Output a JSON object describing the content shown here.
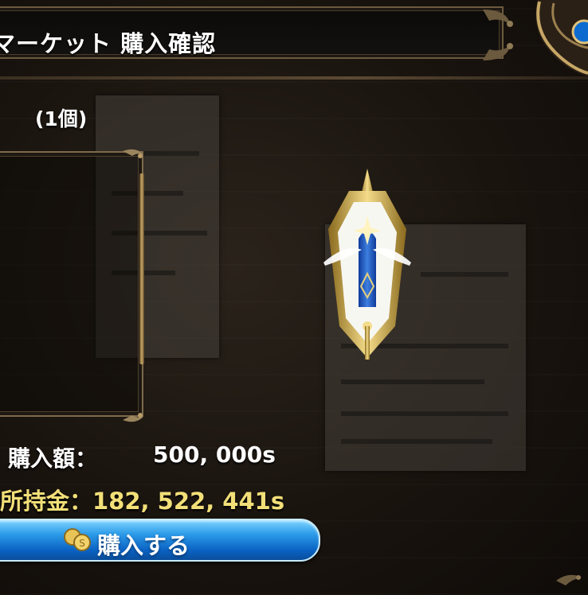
{
  "header": {
    "title": "マーケット 購入確認"
  },
  "item": {
    "quantity": "(1個)",
    "icon": "crystal-emblem-icon"
  },
  "purchase": {
    "price_label": "購入額：",
    "price_value": "500, 000s",
    "money_label": "所持金：",
    "money_value": "182, 522, 441s"
  },
  "buy_button": {
    "label": "購入する",
    "icon": "coin-icon"
  },
  "colors": {
    "money_text": "#f2df78",
    "button_blue": "#0b63c4",
    "frame_gold": "#7d6a4b"
  }
}
